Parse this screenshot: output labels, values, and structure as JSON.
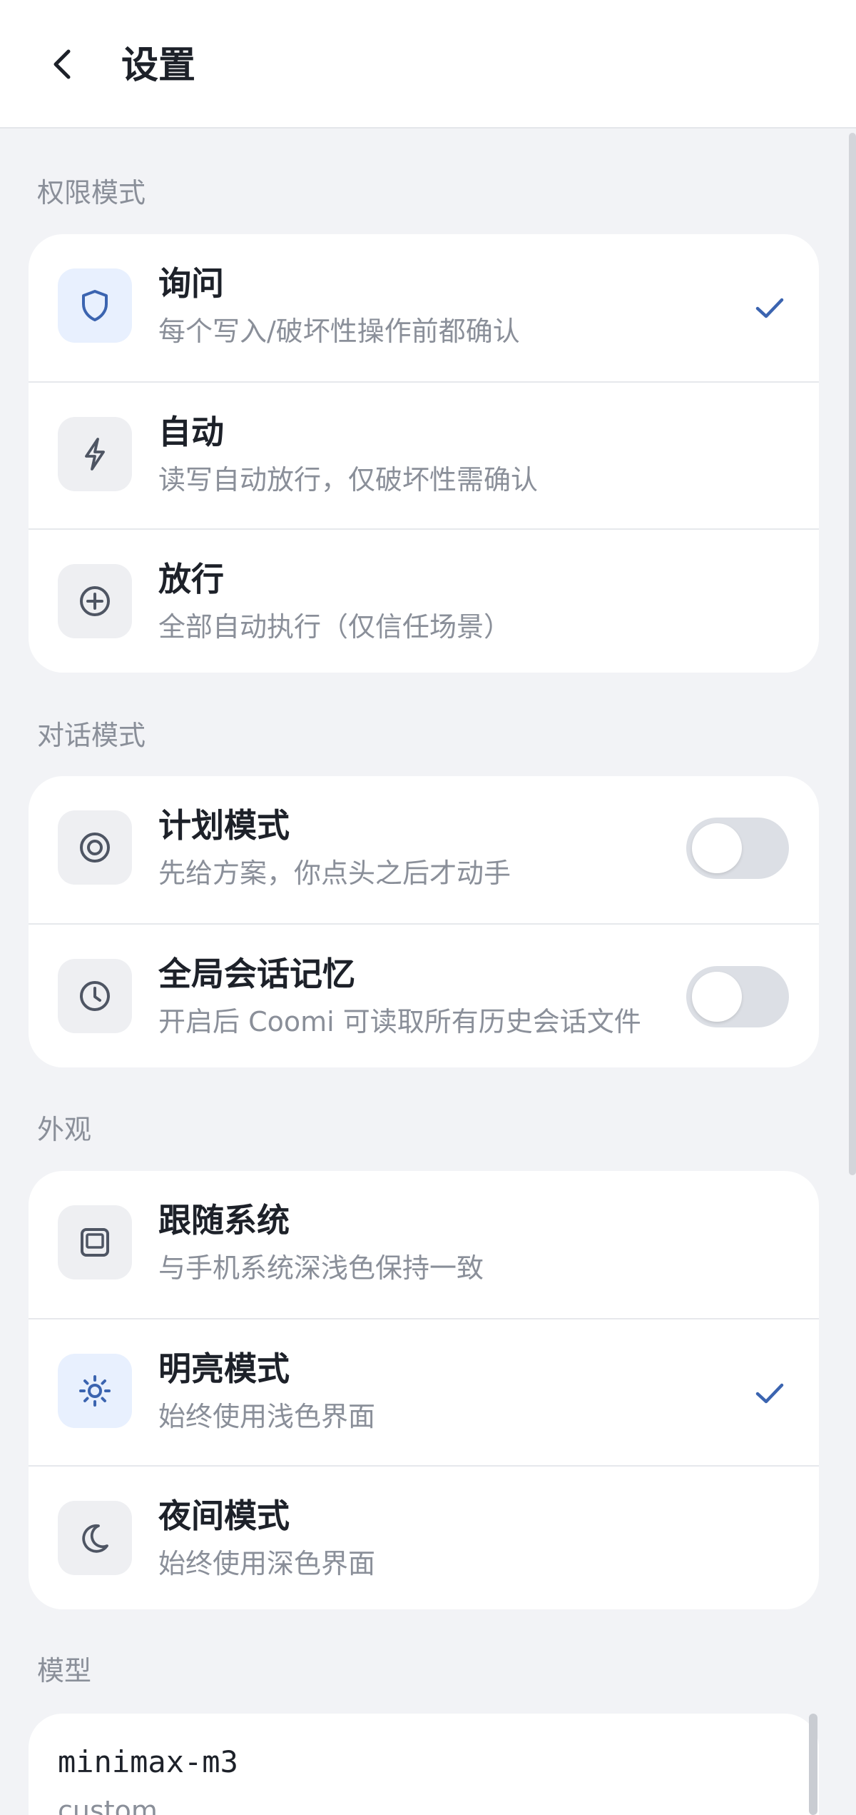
{
  "header": {
    "title": "设置",
    "back_icon": "chevron-left-icon"
  },
  "sections": {
    "permission": {
      "title": "权限模式",
      "items": [
        {
          "label": "询问",
          "description": "每个写入/破坏性操作前都确认",
          "icon": "shield-icon",
          "selected": true
        },
        {
          "label": "自动",
          "description": "读写自动放行，仅破坏性需确认",
          "icon": "lightning-icon",
          "selected": false
        },
        {
          "label": "放行",
          "description": "全部自动执行（仅信任场景）",
          "icon": "plus-circle-icon",
          "selected": false
        }
      ]
    },
    "conversation": {
      "title": "对话模式",
      "items": [
        {
          "label": "计划模式",
          "description": "先给方案，你点头之后才动手",
          "icon": "target-icon",
          "enabled": false
        },
        {
          "label": "全局会话记忆",
          "description": "开启后 Coomi 可读取所有历史会话文件",
          "icon": "clock-icon",
          "enabled": false
        }
      ]
    },
    "appearance": {
      "title": "外观",
      "items": [
        {
          "label": "跟随系统",
          "description": "与手机系统深浅色保持一致",
          "icon": "device-icon",
          "selected": false
        },
        {
          "label": "明亮模式",
          "description": "始终使用浅色界面",
          "icon": "sun-icon",
          "selected": true
        },
        {
          "label": "夜间模式",
          "description": "始终使用深色界面",
          "icon": "moon-icon",
          "selected": false
        }
      ]
    },
    "model": {
      "title": "模型",
      "current": {
        "name": "minimax-m3",
        "provider": "custom"
      }
    }
  },
  "colors": {
    "accent": "#3B64B0",
    "icon_gray": "#4E5563",
    "background": "#F2F3F6",
    "card": "#FFFFFF",
    "toggle_off": "#DCDFE5"
  }
}
